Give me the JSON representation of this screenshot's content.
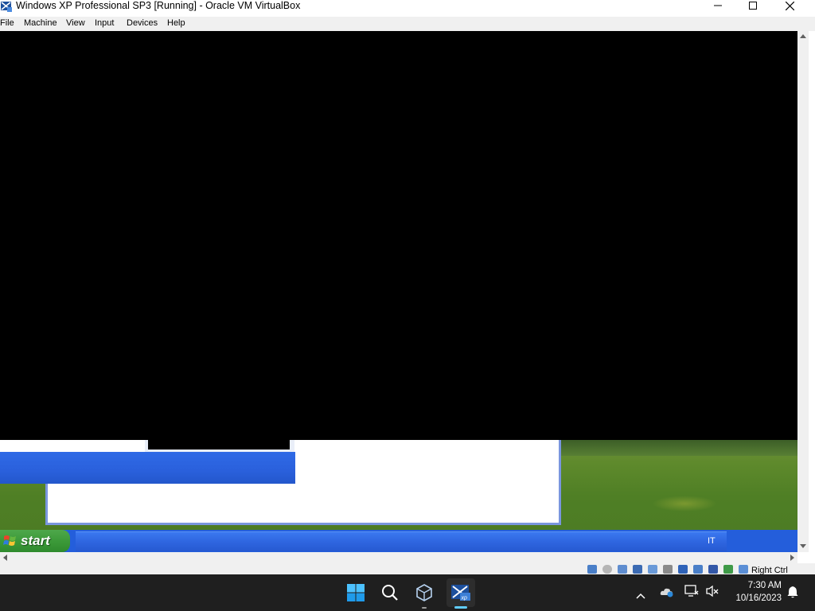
{
  "window": {
    "title": "Windows XP Professional SP3 [Running] - Oracle VM VirtualBox",
    "icon": "virtualbox-icon"
  },
  "menu": {
    "items": [
      "File",
      "Machine",
      "View",
      "Input",
      "Devices",
      "Help"
    ]
  },
  "guest": {
    "start_label": "start",
    "language_indicator": "IT"
  },
  "statusbar": {
    "host_key": "Right Ctrl",
    "icons": [
      "hard-disk-icon",
      "optical-drive-icon",
      "audio-icon",
      "network-icon",
      "usb-icon",
      "shared-folders-icon",
      "display-icon",
      "video-capture-icon",
      "vt-x-icon",
      "mouse-integration-icon",
      "keyboard-icon"
    ]
  },
  "host_taskbar": {
    "apps": [
      "start-icon",
      "search-icon",
      "virtualbox-manager-icon",
      "virtualbox-xp-vm-icon"
    ],
    "tray_icons": [
      "chevron-up-icon",
      "onedrive-icon",
      "network-icon",
      "volume-muted-icon",
      "notification-bell-icon"
    ],
    "time": "7:30 AM",
    "date": "10/16/2023"
  },
  "colors": {
    "xp_taskbar": "#245edb",
    "xp_start": "#3c9a39",
    "host_taskbar": "#1f1f1f",
    "accent": "#60cdff"
  }
}
